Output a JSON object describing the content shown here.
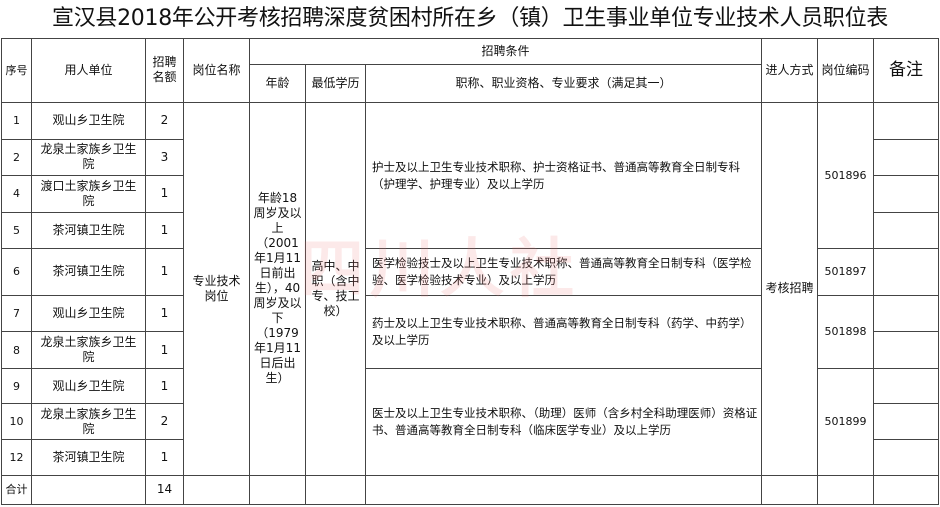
{
  "title": "宣汉县2018年公开考核招聘深度贫困村所在乡（镇）卫生事业单位专业技术人员职位表",
  "headers": {
    "seq": "序号",
    "unit": "用人单位",
    "count": "招聘名额",
    "position": "岗位名称",
    "conditions": "招聘条件",
    "age": "年龄",
    "edu": "最低学历",
    "req": "职称、职业资格、专业要求（满足其一）",
    "method": "进人方式",
    "code": "岗位编码",
    "note": "备注"
  },
  "rows": [
    {
      "seq": "1",
      "unit": "观山乡卫生院",
      "count": "2"
    },
    {
      "seq": "2",
      "unit": "龙泉土家族乡卫生院",
      "count": "3"
    },
    {
      "seq": "4",
      "unit": "渡口土家族乡卫生院",
      "count": "1"
    },
    {
      "seq": "5",
      "unit": "茶河镇卫生院",
      "count": "1"
    },
    {
      "seq": "6",
      "unit": "茶河镇卫生院",
      "count": "1"
    },
    {
      "seq": "7",
      "unit": "观山乡卫生院",
      "count": "1"
    },
    {
      "seq": "8",
      "unit": "龙泉土家族乡卫生院",
      "count": "1"
    },
    {
      "seq": "9",
      "unit": "观山乡卫生院",
      "count": "1"
    },
    {
      "seq": "10",
      "unit": "龙泉土家族乡卫生院",
      "count": "2"
    },
    {
      "seq": "12",
      "unit": "茶河镇卫生院",
      "count": "1"
    }
  ],
  "merged": {
    "position": "专业技术岗位",
    "age": "年龄18周岁及以上（2001年1月11日前出生），40周岁及以下（1979年1月11日后出生）",
    "edu": "高中、中职（含中专、技工校）",
    "method": "考核招聘"
  },
  "groups": [
    {
      "req": "护士及以上卫生专业技术职称、护士资格证书、普通高等教育全日制专科（护理学、护理专业）及以上学历",
      "code": "501896"
    },
    {
      "req": "医学检验技士及以上卫生专业技术职称、普通高等教育全日制专科（医学检验、医学检验技术专业）及以上学历",
      "code": "501897"
    },
    {
      "req": "药士及以上卫生专业技术职称、普通高等教育全日制专科（药学、中药学）及以上学历",
      "code": "501898"
    },
    {
      "req": "医士及以上卫生专业技术职称、（助理）医师（含乡村全科助理医师）资格证书、普通高等教育全日制专科（临床医学专业）及以上学历",
      "code": "501899"
    }
  ],
  "total": {
    "label": "合计",
    "count": "14"
  },
  "watermark": "四川人社"
}
